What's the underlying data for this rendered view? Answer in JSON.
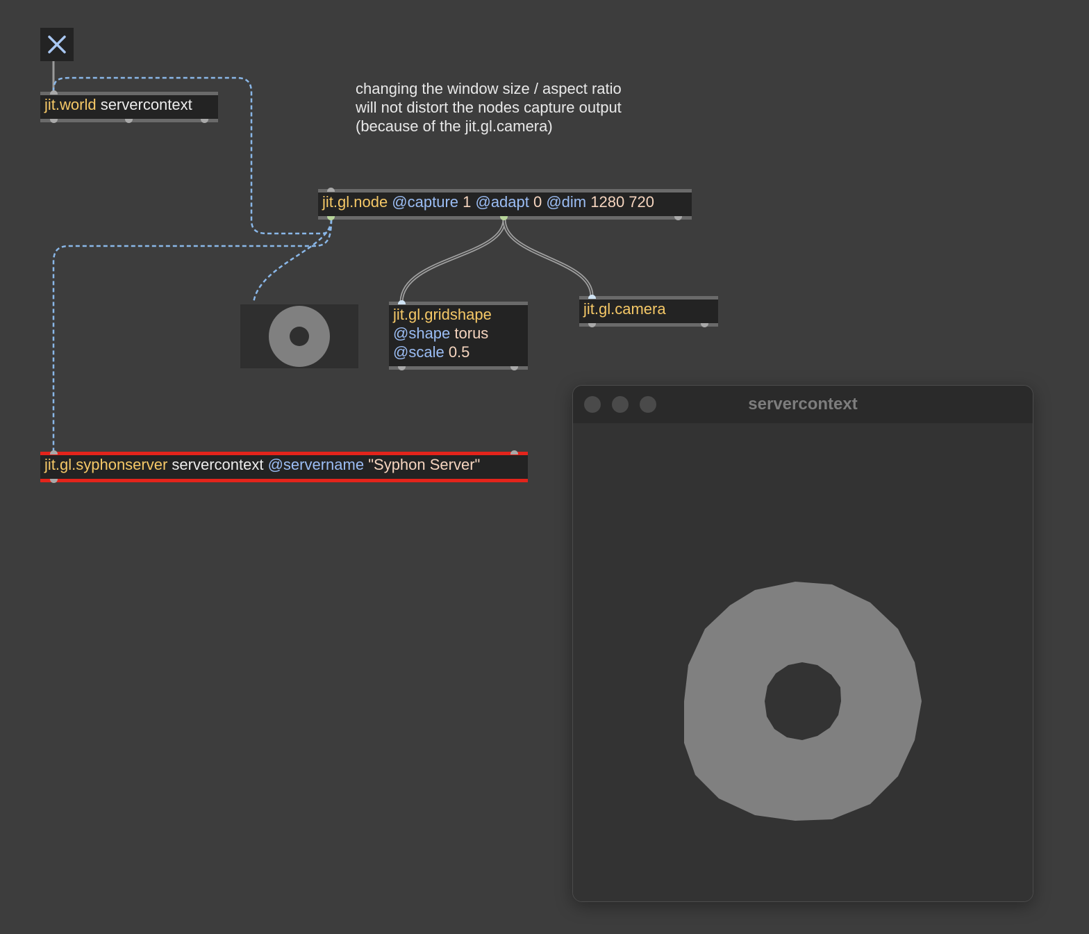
{
  "patcher": {
    "toggle": {
      "icon": "close-icon"
    },
    "comment": [
      "changing the window size / aspect ratio",
      "will not distort the nodes capture output",
      "(because of the jit.gl.camera)"
    ],
    "world_object": {
      "class": "jit.world",
      "args": " servercontext"
    },
    "node_object": {
      "class": "jit.gl.node",
      "attr1": " @capture",
      "val1": " 1",
      "attr2": " @adapt",
      "val2": " 0",
      "attr3": " @dim",
      "val3": " 1280 720"
    },
    "gridshape_object": {
      "class": "jit.gl.gridshape",
      "attr1": "@shape",
      "val1": " torus",
      "attr2": "@scale",
      "val2": " 0.5"
    },
    "camera_object": {
      "class": "jit.gl.camera"
    },
    "syphon_object": {
      "class": "jit.gl.syphonserver",
      "args": " servercontext",
      "attr": " @servername",
      "val": " \"Syphon Server\""
    }
  },
  "render_window": {
    "title": "servercontext"
  },
  "colors": {
    "background": "#3d3d3d",
    "object_class": "#f5c867",
    "attribute": "#9bbdf4",
    "value": "#f6d5bf",
    "error_border": "#e3241b",
    "patch_cable": "#8ab7e8",
    "shape_fill": "#808080"
  }
}
